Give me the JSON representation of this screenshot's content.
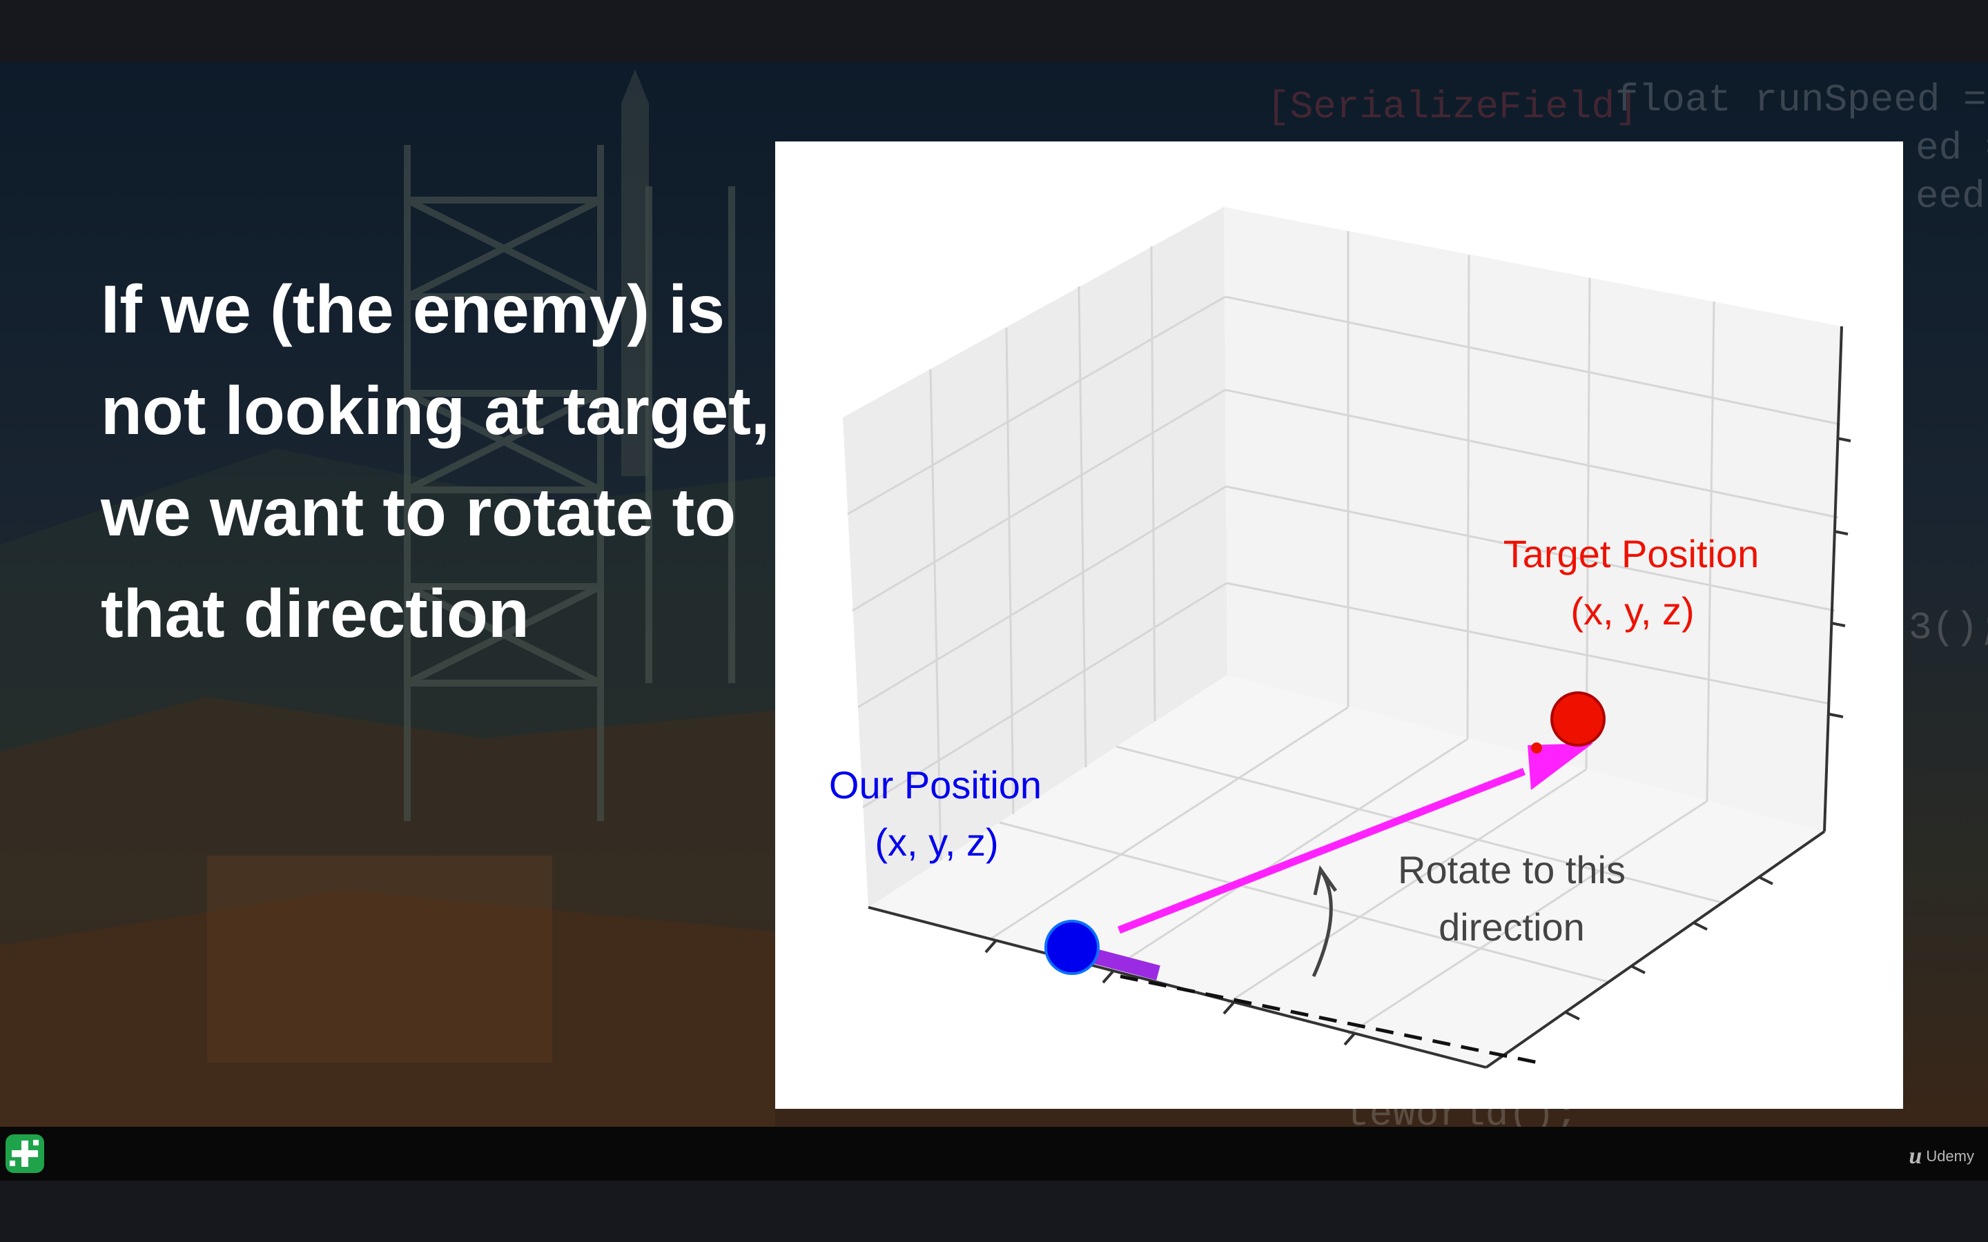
{
  "slide": {
    "heading": "If we (the enemy) is not looking at target, we want to rotate to that direction",
    "background_code": {
      "line1_keyword": "[SerializeField]",
      "line1_rest": " float runSpeed =",
      "line2": "ed =",
      "line3": "eed",
      "line4": "3();",
      "line5": "teWorld();"
    }
  },
  "diagram": {
    "our_position": {
      "title": "Our Position",
      "coords": "(x, y, z)",
      "color": "#0000ee"
    },
    "target_position": {
      "title": "Target Position",
      "coords": "(x, y, z)",
      "color": "#ee1100"
    },
    "rotate_label": {
      "line1": "Rotate to this",
      "line2": "direction"
    },
    "arrow_color": "#ff22ff",
    "forward_color": "#9a2be2"
  },
  "footer": {
    "brand": "Udemy",
    "brand_mark": "u"
  }
}
